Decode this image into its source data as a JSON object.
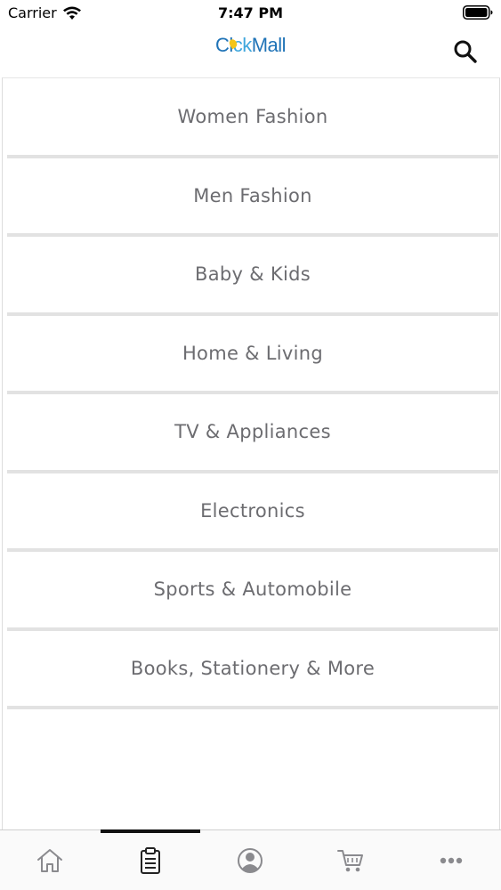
{
  "status_bar": {
    "carrier": "Carrier",
    "time": "7:47 PM"
  },
  "header": {
    "logo_part1": "Cl",
    "logo_part2": "ck",
    "logo_part3": "Mall",
    "brand_colors": {
      "primary": "#1f73b7",
      "secondary": "#3fa7dd",
      "accent": "#f5c518"
    }
  },
  "categories": [
    {
      "label": "Women Fashion"
    },
    {
      "label": "Men Fashion"
    },
    {
      "label": "Baby & Kids"
    },
    {
      "label": "Home & Living"
    },
    {
      "label": "TV & Appliances"
    },
    {
      "label": "Electronics"
    },
    {
      "label": "Sports & Automobile"
    },
    {
      "label": "Books, Stationery & More"
    }
  ],
  "tab_bar": {
    "tabs": [
      {
        "icon": "home-icon",
        "active": false
      },
      {
        "icon": "clipboard-icon",
        "active": true
      },
      {
        "icon": "profile-icon",
        "active": false
      },
      {
        "icon": "cart-icon",
        "active": false
      },
      {
        "icon": "more-icon",
        "active": false
      }
    ],
    "active_indicator_color": "#111111"
  }
}
